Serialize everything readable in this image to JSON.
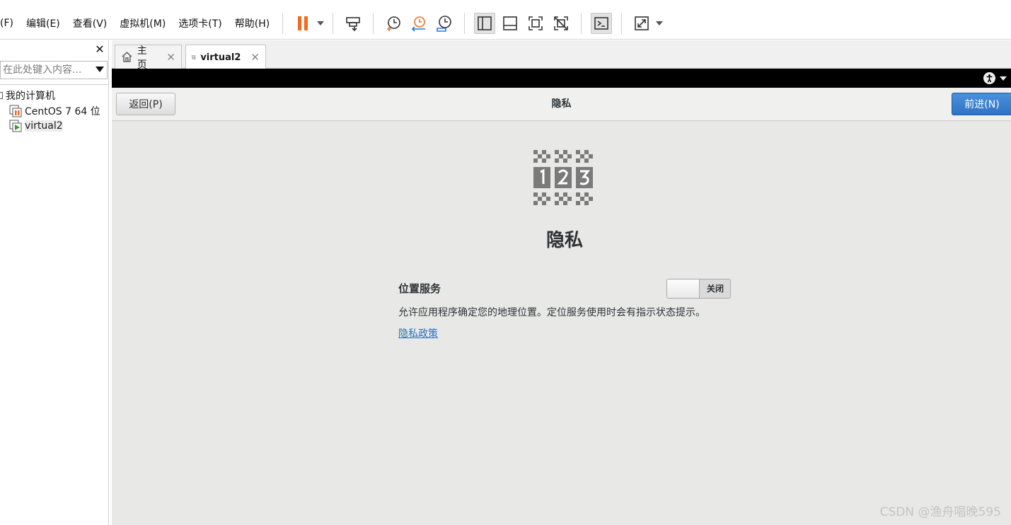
{
  "menubar": {
    "items": [
      "(F)",
      "编辑(E)",
      "查看(V)",
      "虚拟机(M)",
      "选项卡(T)",
      "帮助(H)"
    ]
  },
  "toolbar": {
    "icons": [
      "pause-icon",
      "send-keys-icon",
      "snapshot-icon",
      "revert-snapshot-icon",
      "snapshot-manager-icon",
      "sidebar-view-icon",
      "thumbnail-view-icon",
      "fullscreen-icon",
      "unity-icon",
      "console-icon",
      "stretch-icon"
    ]
  },
  "sidebar": {
    "search_placeholder": "在此处键入内容...",
    "tree": {
      "root_label": "我的计算机",
      "items": [
        {
          "label": "CentOS 7 64 位",
          "icon": "vm-paused-icon"
        },
        {
          "label": "virtual2",
          "icon": "vm-running-icon"
        }
      ]
    }
  },
  "tabs": [
    {
      "label": "主页",
      "icon": "home-icon",
      "active": false
    },
    {
      "label": "virtual2",
      "icon": "vm-running-icon",
      "active": true
    }
  ],
  "vm": {
    "header": {
      "back_label": "返回(P)",
      "title": "隐私",
      "next_label": "前进(N)"
    },
    "page": {
      "heading": "隐私",
      "location_label": "位置服务",
      "toggle_state": "关闭",
      "location_description": "允许应用程序确定您的地理位置。定位服务使用时会有指示状态提示。",
      "privacy_link": "隐私政策"
    }
  },
  "watermark": "CSDN @渔舟唱晚595",
  "colors": {
    "accent_blue": "#3584e4",
    "pause_orange": "#f26b21",
    "vm_bg": "#e8e8e7"
  }
}
